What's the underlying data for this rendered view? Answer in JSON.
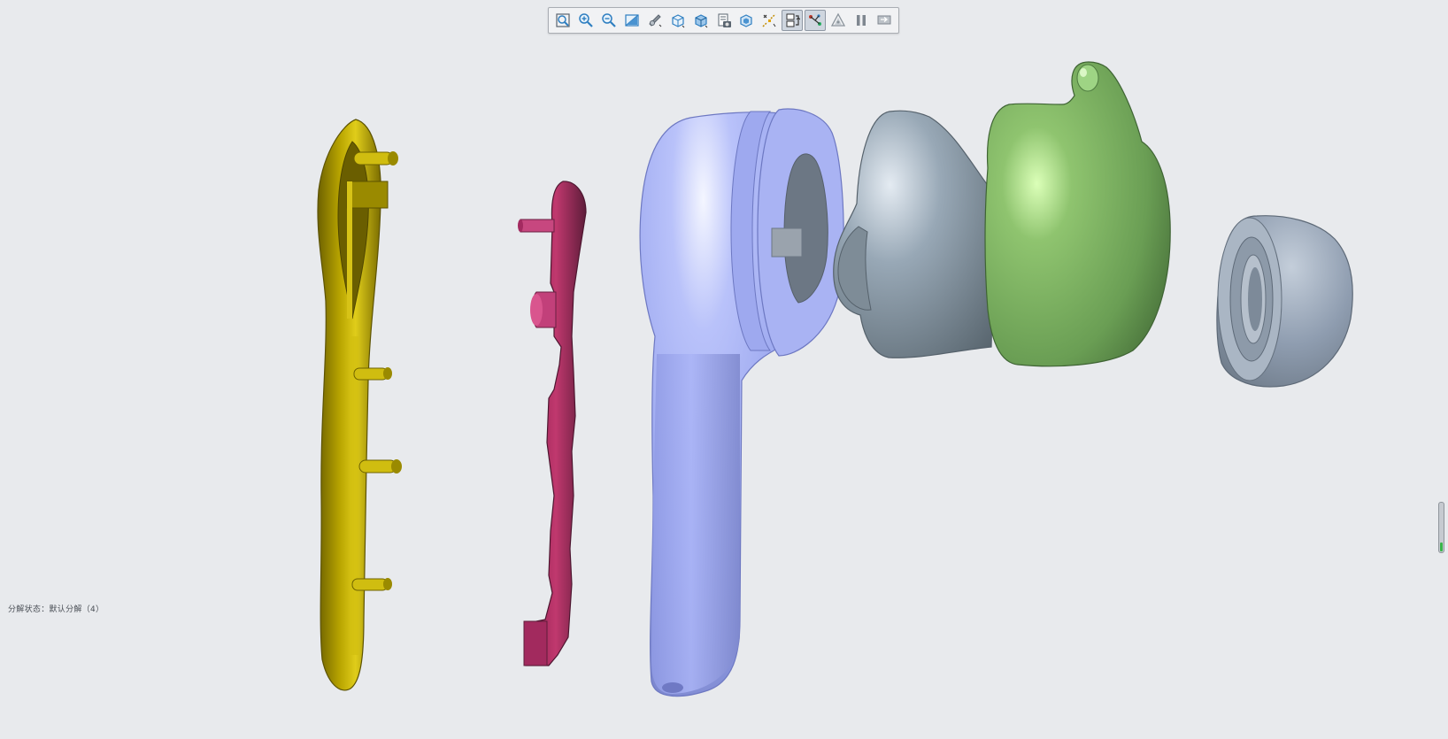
{
  "toolbar": {
    "buttons": [
      {
        "icon": "zoom-fit-icon",
        "active": false
      },
      {
        "icon": "zoom-in-icon",
        "active": false
      },
      {
        "icon": "zoom-out-icon",
        "active": false
      },
      {
        "icon": "zoom-window-icon",
        "active": false
      },
      {
        "icon": "render-style-icon",
        "active": false
      },
      {
        "icon": "view-orientation-icon",
        "active": false
      },
      {
        "icon": "display-style-icon",
        "active": false
      },
      {
        "icon": "section-view-icon",
        "active": false
      },
      {
        "icon": "scene-icon",
        "active": false
      },
      {
        "icon": "explode-lines-icon",
        "active": false
      },
      {
        "icon": "explode-view-icon",
        "active": true
      },
      {
        "icon": "path-icon",
        "active": true
      },
      {
        "icon": "shadow-icon",
        "active": false
      },
      {
        "icon": "pause-icon",
        "active": false
      },
      {
        "icon": "exit-icon",
        "active": false
      }
    ]
  },
  "status": {
    "text": "分解状态：默认分解（4）"
  },
  "model": {
    "parts": [
      {
        "name": "back-cover",
        "color": "#b3a000"
      },
      {
        "name": "circuit-board",
        "color": "#a8285d"
      },
      {
        "name": "earbud-housing",
        "color": "#a3aef2"
      },
      {
        "name": "acoustic-nozzle",
        "color": "#8797a6"
      },
      {
        "name": "ear-fin",
        "color": "#7fb065"
      },
      {
        "name": "ear-tip",
        "color": "#8f9db0"
      }
    ]
  },
  "colors": {
    "background": "#e8eaed",
    "toolbar_background": "#f1f2f4",
    "indicator_green": "#39b54a"
  }
}
